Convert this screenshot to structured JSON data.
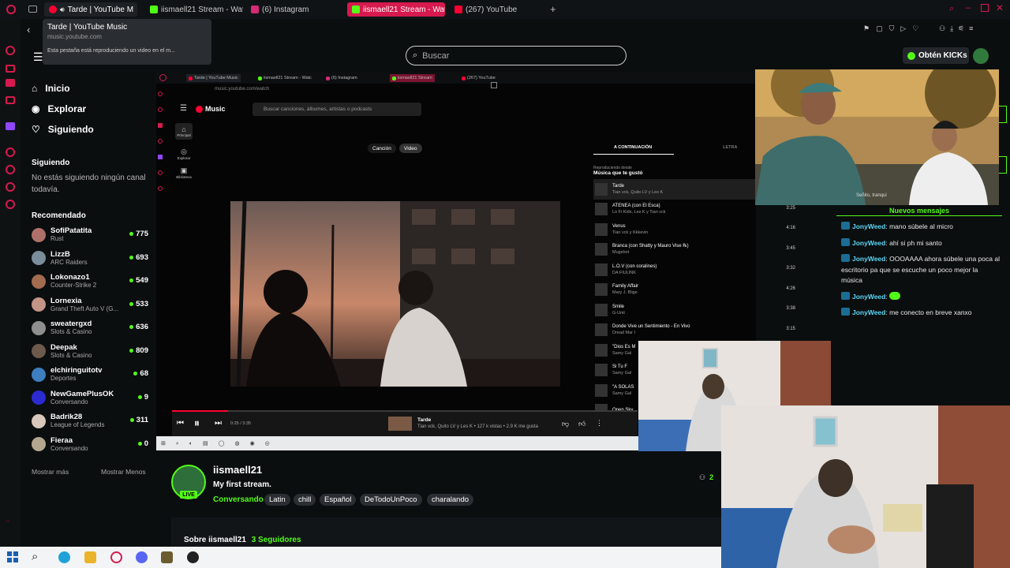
{
  "browser": {
    "tabs": [
      {
        "label": "Tarde | YouTube M",
        "active": true
      },
      {
        "label": "iismaell21 Stream - Watch",
        "active": false
      },
      {
        "label": "(6) Instagram",
        "active": false
      },
      {
        "label": "iismaell21 Stream - Watch",
        "active": false,
        "highlight": true
      },
      {
        "label": "(267) YouTube",
        "active": false
      }
    ],
    "new_tab": "+",
    "tooltip": {
      "title": "Tarde | YouTube Music",
      "url": "music.youtube.com",
      "note": "Esta pestaña está reproduciendo un video en el m..."
    }
  },
  "kick": {
    "search_placeholder": "Buscar",
    "get_kicks": "Obtén KICKs",
    "nav": [
      {
        "icon": "home-icon",
        "label": "Inicio"
      },
      {
        "icon": "compass-icon",
        "label": "Explorar"
      },
      {
        "icon": "heart-icon",
        "label": "Siguiendo"
      }
    ],
    "following_title": "Siguiendo",
    "following_empty": "No estás siguiendo ningún canal todavía.",
    "recommended_title": "Recomendado",
    "recommended": [
      {
        "name": "SofiPatatita",
        "game": "Rust",
        "viewers": "775",
        "color": "#b0706a"
      },
      {
        "name": "LizzB",
        "game": "ARC Raiders",
        "viewers": "693",
        "color": "#7a8d9a"
      },
      {
        "name": "Lokonazo1",
        "game": "Counter-Strike 2",
        "viewers": "549",
        "color": "#a36b4f"
      },
      {
        "name": "Lornexia",
        "game": "Grand Theft Auto V (G...",
        "viewers": "533",
        "color": "#c49486"
      },
      {
        "name": "sweatergxd",
        "game": "Slots & Casino",
        "viewers": "636",
        "color": "#8f8f8f"
      },
      {
        "name": "Deepak",
        "game": "Slots & Casino",
        "viewers": "809",
        "color": "#6d5a4c"
      },
      {
        "name": "elchiringuitotv",
        "game": "Deportes",
        "viewers": "68",
        "color": "#3d7fc1"
      },
      {
        "name": "NewGamePlusOK",
        "game": "Conversando",
        "viewers": "9",
        "color": "#2b2bd1"
      },
      {
        "name": "Badrik28",
        "game": "League of Legends",
        "viewers": "311",
        "color": "#d8c7bb"
      },
      {
        "name": "Fieraa",
        "game": "Conversando",
        "viewers": "0",
        "color": "#b3a68f"
      }
    ],
    "show_more": "Mostrar más",
    "show_less": "Mostrar Menos",
    "channel": {
      "name": "iismaell21",
      "title": "My first stream.",
      "live": "LIVE",
      "category": "Conversando",
      "tags": [
        "Latin",
        "chill",
        "Español",
        "DeTodoUnPoco",
        "charalando"
      ],
      "viewers": "2",
      "about": "Sobre iismaell21",
      "followers": "3 Seguidores"
    },
    "chat": {
      "new_messages": "Nuevos mensajes",
      "messages": [
        {
          "user": "JonyWeed",
          "text": "mano súbele al micro"
        },
        {
          "user": "JonyWeed",
          "text": "ahí si ph mi santo"
        },
        {
          "user": "JonyWeed",
          "text": "OOOAAAA ahora súbele una poca al escritorio pa que se escuche un poco mejor la música"
        },
        {
          "user": "JonyWeed",
          "text": ""
        },
        {
          "user": "JonyWeed",
          "text": "me conecto en breve xanxo"
        }
      ]
    }
  },
  "shared_screen": {
    "tabs": [
      "Tarde | YouTube Music",
      "iismaell21 Stream - Watc",
      "(6) Instagram",
      "iismaell21 Stream",
      "(267) YouTube"
    ],
    "url": "music.youtube.com/watch",
    "yt_logo": "Music",
    "yt_search": "Buscar canciones, álbumes, artistas o podcasts",
    "side": [
      "Principal",
      "Explorar",
      "Biblioteca"
    ],
    "toggle": [
      "Canción",
      "Video"
    ],
    "queue_tabs": [
      "A CONTINUACIÓN",
      "LETRA"
    ],
    "queue_from": "Reproduciendo desde",
    "queue_playlist": "Música que te gustó",
    "queue": [
      {
        "title": "Tarde",
        "artist": "Tian vck, Quito LV y Les K",
        "dur": ""
      },
      {
        "title": "ATENEA (con El Esca)",
        "artist": "Lo Fi Kids, Les K y Tian vck",
        "dur": "3:25"
      },
      {
        "title": "Venus",
        "artist": "Tian vck y Kkkevin",
        "dur": "4:16"
      },
      {
        "title": "Branca (con Shatty y Mauro Vise ℞)",
        "artist": "Mugshot",
        "dur": "3:45"
      },
      {
        "title": "L.O.V (con coralines)",
        "artist": "DA FIULINK",
        "dur": "3:32"
      },
      {
        "title": "Family Affair",
        "artist": "Mary J. Blige",
        "dur": "4:26"
      },
      {
        "title": "Smile",
        "artist": "G-Unit",
        "dur": "3:38"
      },
      {
        "title": "Donde Vive un Sentimiento - En Vivo",
        "artist": "Dread Mar I",
        "dur": "3:15"
      },
      {
        "title": "\"Dios Es M",
        "artist": "Samy Gal",
        "dur": ""
      },
      {
        "title": "Si Tu F",
        "artist": "Samy Gal",
        "dur": ""
      },
      {
        "title": "\"A SOLAS",
        "artist": "Samy Gal",
        "dur": ""
      },
      {
        "title": "Open Sky",
        "artist": "",
        "dur": ""
      }
    ],
    "now_playing": {
      "time": "0:25 / 3:35",
      "title": "Tarde",
      "meta": "Tian vck, Quito LV y Les K • 127 k vistas • 2.9 K me gusta",
      "progress": 0.12
    },
    "cam_caption": "Señito, tranqui"
  }
}
